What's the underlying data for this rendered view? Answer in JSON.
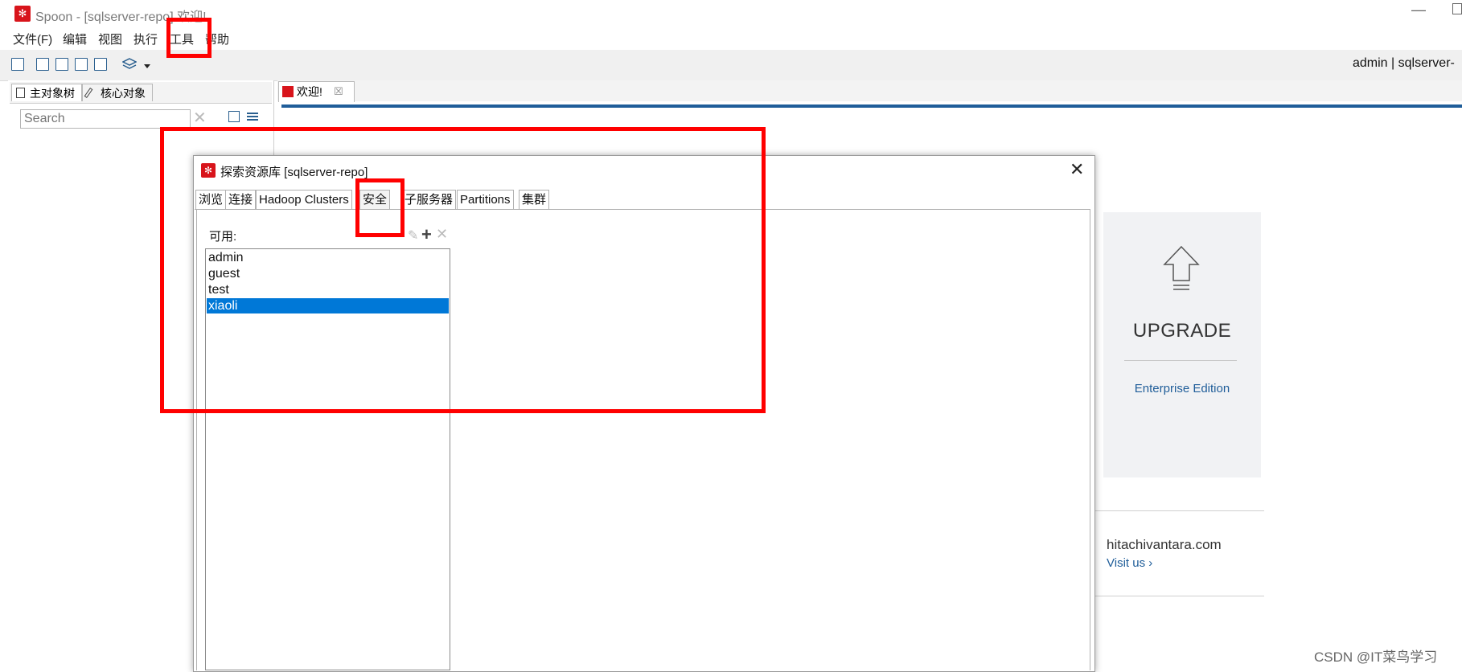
{
  "window": {
    "title": "Spoon - [sqlserver-repo] 欢迎!",
    "minimize": "—"
  },
  "menubar": [
    "文件(F)",
    "编辑",
    "视图",
    "执行",
    "工具",
    "帮助"
  ],
  "toolbar": {
    "user_info": "admin  |  sqlserver-"
  },
  "left_panel": {
    "tabs": [
      "主对象树",
      "核心对象"
    ],
    "search_placeholder": "Search",
    "search_clear": "✕"
  },
  "editor": {
    "tabs": [
      {
        "label": "欢迎!",
        "close": "☒"
      }
    ]
  },
  "welcome": {
    "upgrade_title": "UPGRADE",
    "enterprise_link": "Enterprise Edition",
    "site": "hitachivantara.com",
    "visit_link": "Visit us ›"
  },
  "dialog": {
    "title": "探索资源库 [sqlserver-repo]",
    "close": "✕",
    "tabs": [
      "浏览",
      "连接",
      "Hadoop Clusters",
      "安全",
      "子服务器",
      "Partitions",
      "集群"
    ],
    "active_tab": "安全",
    "available_label": "可用:",
    "edit_icon": "✎",
    "add_icon": "+",
    "remove_icon": "✕",
    "users": [
      "admin",
      "guest",
      "test",
      "xiaoli"
    ],
    "selected_user": "xiaoli"
  },
  "watermark": "CSDN @IT菜鸟学习",
  "colors": {
    "brand_red": "#d8141b",
    "selection_blue": "#0078d7",
    "accent_blue": "#1f5d99",
    "annotation_red": "#ff0000"
  }
}
